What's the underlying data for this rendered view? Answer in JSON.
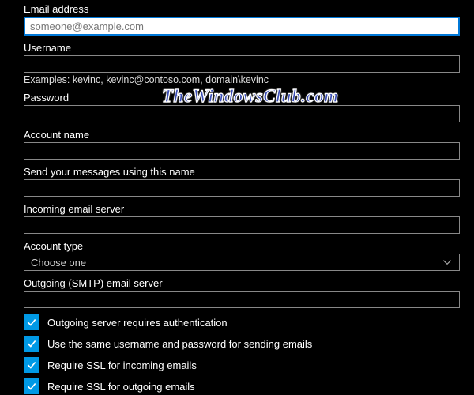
{
  "watermark": "TheWindowsClub.com",
  "fields": {
    "email": {
      "label": "Email address",
      "placeholder": "someone@example.com"
    },
    "username": {
      "label": "Username",
      "hint": "Examples: kevinc, kevinc@contoso.com, domain\\kevinc"
    },
    "password": {
      "label": "Password"
    },
    "account_name": {
      "label": "Account name"
    },
    "display_name": {
      "label": "Send your messages using this name"
    },
    "incoming": {
      "label": "Incoming email server"
    },
    "account_type": {
      "label": "Account type",
      "selected": "Choose one"
    },
    "outgoing": {
      "label": "Outgoing (SMTP) email server"
    }
  },
  "checkboxes": {
    "auth": {
      "label": "Outgoing server requires authentication",
      "checked": true
    },
    "same_creds": {
      "label": "Use the same username and password for sending emails",
      "checked": true
    },
    "ssl_in": {
      "label": "Require SSL for incoming emails",
      "checked": true
    },
    "ssl_out": {
      "label": "Require SSL for outgoing emails",
      "checked": true
    }
  },
  "colors": {
    "accent": "#0078d7",
    "checkbox": "#0099e5"
  }
}
